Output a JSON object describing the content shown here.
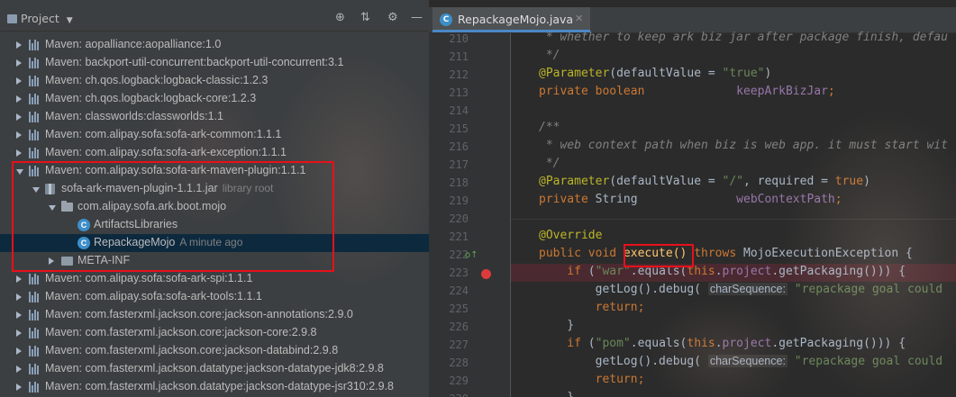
{
  "project_panel": {
    "title": "Project",
    "toolbar_icons": [
      "crosshair-icon",
      "collapse-icon",
      "gear-icon",
      "minimize-icon"
    ],
    "tree": [
      {
        "label": "Maven: aopalliance:aopalliance:1.0",
        "icon": "library-icon",
        "expanded": false
      },
      {
        "label": "Maven: backport-util-concurrent:backport-util-concurrent:3.1",
        "icon": "library-icon",
        "expanded": false
      },
      {
        "label": "Maven: ch.qos.logback:logback-classic:1.2.3",
        "icon": "library-icon",
        "expanded": false
      },
      {
        "label": "Maven: ch.qos.logback:logback-core:1.2.3",
        "icon": "library-icon",
        "expanded": false
      },
      {
        "label": "Maven: classworlds:classworlds:1.1",
        "icon": "library-icon",
        "expanded": false
      },
      {
        "label": "Maven: com.alipay.sofa:sofa-ark-common:1.1.1",
        "icon": "library-icon",
        "expanded": false
      },
      {
        "label": "Maven: com.alipay.sofa:sofa-ark-exception:1.1.1",
        "icon": "library-icon",
        "expanded": false
      },
      {
        "label": "Maven: com.alipay.sofa:sofa-ark-maven-plugin:1.1.1",
        "icon": "library-icon",
        "expanded": true
      },
      {
        "label": "sofa-ark-maven-plugin-1.1.1.jar",
        "suffix": "library root",
        "icon": "jar-icon",
        "expanded": true
      },
      {
        "label": "com.alipay.sofa.ark.boot.mojo",
        "icon": "package-icon",
        "expanded": true
      },
      {
        "label": "ArtifactsLibraries",
        "icon": "class-icon"
      },
      {
        "label": "RepackageMojo",
        "suffix": "A minute ago",
        "icon": "class-icon",
        "selected": true
      },
      {
        "label": "META-INF",
        "icon": "folder-icon",
        "expanded": false
      },
      {
        "label": "Maven: com.alipay.sofa:sofa-ark-spi:1.1.1",
        "icon": "library-icon",
        "expanded": false
      },
      {
        "label": "Maven: com.alipay.sofa:sofa-ark-tools:1.1.1",
        "icon": "library-icon",
        "expanded": false
      },
      {
        "label": "Maven: com.fasterxml.jackson.core:jackson-annotations:2.9.0",
        "icon": "library-icon",
        "expanded": false
      },
      {
        "label": "Maven: com.fasterxml.jackson.core:jackson-core:2.9.8",
        "icon": "library-icon",
        "expanded": false
      },
      {
        "label": "Maven: com.fasterxml.jackson.core:jackson-databind:2.9.8",
        "icon": "library-icon",
        "expanded": false
      },
      {
        "label": "Maven: com.fasterxml.jackson.datatype:jackson-datatype-jdk8:2.9.8",
        "icon": "library-icon",
        "expanded": false
      },
      {
        "label": "Maven: com.fasterxml.jackson.datatype:jackson-datatype-jsr310:2.9.8",
        "icon": "library-icon",
        "expanded": false
      }
    ]
  },
  "editor": {
    "tab": {
      "label": "RepackageMojo.java",
      "icon": "class-icon"
    },
    "lines": [
      {
        "num": "210",
        "tokens": [
          {
            "t": " * whether to keep ark biz jar after package finish, defau",
            "c": "com"
          }
        ]
      },
      {
        "num": "211",
        "tokens": [
          {
            "t": " */",
            "c": "com"
          }
        ]
      },
      {
        "num": "212",
        "tokens": [
          {
            "t": "@Parameter",
            "c": "ann"
          },
          {
            "t": "(defaultValue = ",
            "c": "txt"
          },
          {
            "t": "\"true\"",
            "c": "str"
          },
          {
            "t": ")",
            "c": "txt"
          }
        ]
      },
      {
        "num": "213",
        "tokens": [
          {
            "t": "private boolean",
            "c": "kw"
          },
          {
            "t": "             ",
            "c": "txt"
          },
          {
            "t": "keepArkBizJar",
            "c": "fld"
          },
          {
            "t": ";",
            "c": "kw"
          }
        ]
      },
      {
        "num": "214",
        "tokens": []
      },
      {
        "num": "215",
        "tokens": [
          {
            "t": "/**",
            "c": "com"
          }
        ]
      },
      {
        "num": "216",
        "tokens": [
          {
            "t": " * web context path when biz is web app. it must start wit",
            "c": "com"
          }
        ]
      },
      {
        "num": "217",
        "tokens": [
          {
            "t": " */",
            "c": "com"
          }
        ]
      },
      {
        "num": "218",
        "tokens": [
          {
            "t": "@Parameter",
            "c": "ann"
          },
          {
            "t": "(defaultValue = ",
            "c": "txt"
          },
          {
            "t": "\"/\"",
            "c": "str"
          },
          {
            "t": ", required = ",
            "c": "txt"
          },
          {
            "t": "true",
            "c": "kw"
          },
          {
            "t": ")",
            "c": "txt"
          }
        ]
      },
      {
        "num": "219",
        "tokens": [
          {
            "t": "private ",
            "c": "kw"
          },
          {
            "t": "String",
            "c": "txt"
          },
          {
            "t": "              ",
            "c": "txt"
          },
          {
            "t": "webContextPath",
            "c": "fld"
          },
          {
            "t": ";",
            "c": "kw"
          }
        ]
      },
      {
        "num": "220",
        "tokens": []
      },
      {
        "num": "221",
        "tokens": [
          {
            "t": "@Override",
            "c": "ann"
          }
        ]
      },
      {
        "num": "222",
        "tokens": [
          {
            "t": "public void ",
            "c": "kw"
          },
          {
            "t": "execute()",
            "c": "fn"
          },
          {
            "t": " throws ",
            "c": "kw"
          },
          {
            "t": "MojoExecutionException {",
            "c": "txt"
          }
        ]
      },
      {
        "num": "223",
        "tokens": [
          {
            "t": "    if ",
            "c": "kw"
          },
          {
            "t": "(",
            "c": "txt"
          },
          {
            "t": "\"war\"",
            "c": "str"
          },
          {
            "t": ".equals(",
            "c": "txt"
          },
          {
            "t": "this",
            "c": "kw"
          },
          {
            "t": ".",
            "c": "txt"
          },
          {
            "t": "project",
            "c": "fld"
          },
          {
            "t": ".getPackaging())) {",
            "c": "txt"
          }
        ]
      },
      {
        "num": "224",
        "tokens": [
          {
            "t": "        getLog().debug( ",
            "c": "txt"
          },
          {
            "t": "charSequence:",
            "c": "hint"
          },
          {
            "t": " ",
            "c": "txt"
          },
          {
            "t": "\"repackage goal could",
            "c": "str"
          }
        ]
      },
      {
        "num": "225",
        "tokens": [
          {
            "t": "        return",
            "c": "kw"
          },
          {
            "t": ";",
            "c": "kw"
          }
        ]
      },
      {
        "num": "226",
        "tokens": [
          {
            "t": "    }",
            "c": "txt"
          }
        ]
      },
      {
        "num": "227",
        "tokens": [
          {
            "t": "    if ",
            "c": "kw"
          },
          {
            "t": "(",
            "c": "txt"
          },
          {
            "t": "\"pom\"",
            "c": "str"
          },
          {
            "t": ".equals(",
            "c": "txt"
          },
          {
            "t": "this",
            "c": "kw"
          },
          {
            "t": ".",
            "c": "txt"
          },
          {
            "t": "project",
            "c": "fld"
          },
          {
            "t": ".getPackaging())) {",
            "c": "txt"
          }
        ]
      },
      {
        "num": "228",
        "tokens": [
          {
            "t": "        getLog().debug( ",
            "c": "txt"
          },
          {
            "t": "charSequence:",
            "c": "hint"
          },
          {
            "t": " ",
            "c": "txt"
          },
          {
            "t": "\"repackage goal could",
            "c": "str"
          }
        ]
      },
      {
        "num": "229",
        "tokens": [
          {
            "t": "        return",
            "c": "kw"
          },
          {
            "t": ";",
            "c": "kw"
          }
        ]
      },
      {
        "num": "230",
        "tokens": [
          {
            "t": "    }",
            "c": "txt"
          }
        ]
      }
    ]
  },
  "colors": {
    "selection": "#0d293e",
    "highlight_box": "#e8101a",
    "breakpoint": "#db3b3b",
    "breakpoint_line": "#4a2a30"
  }
}
